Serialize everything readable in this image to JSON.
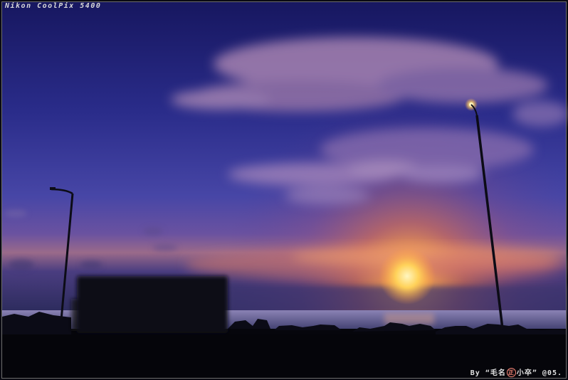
{
  "watermark": {
    "camera": "Nikon CoolPix 5400",
    "credit_prefix": "By “毛名",
    "credit_seal": "正",
    "credit_suffix": "小卒” @05."
  },
  "colors": {
    "sky_top": "#20206e",
    "sky_mid": "#3c3ea0",
    "sky_low": "#6a55a8",
    "horizon_glow": "#e88a5a",
    "sun": "#ffd76a",
    "sea": "#7a7aa8",
    "foreground": "#06060c",
    "lamp": "#ffe9a0"
  },
  "scene": {
    "elements": [
      "sky",
      "clouds",
      "setting-sun",
      "sea",
      "rocks",
      "truck-silhouette",
      "street-lamp-left",
      "street-lamp-right"
    ]
  }
}
